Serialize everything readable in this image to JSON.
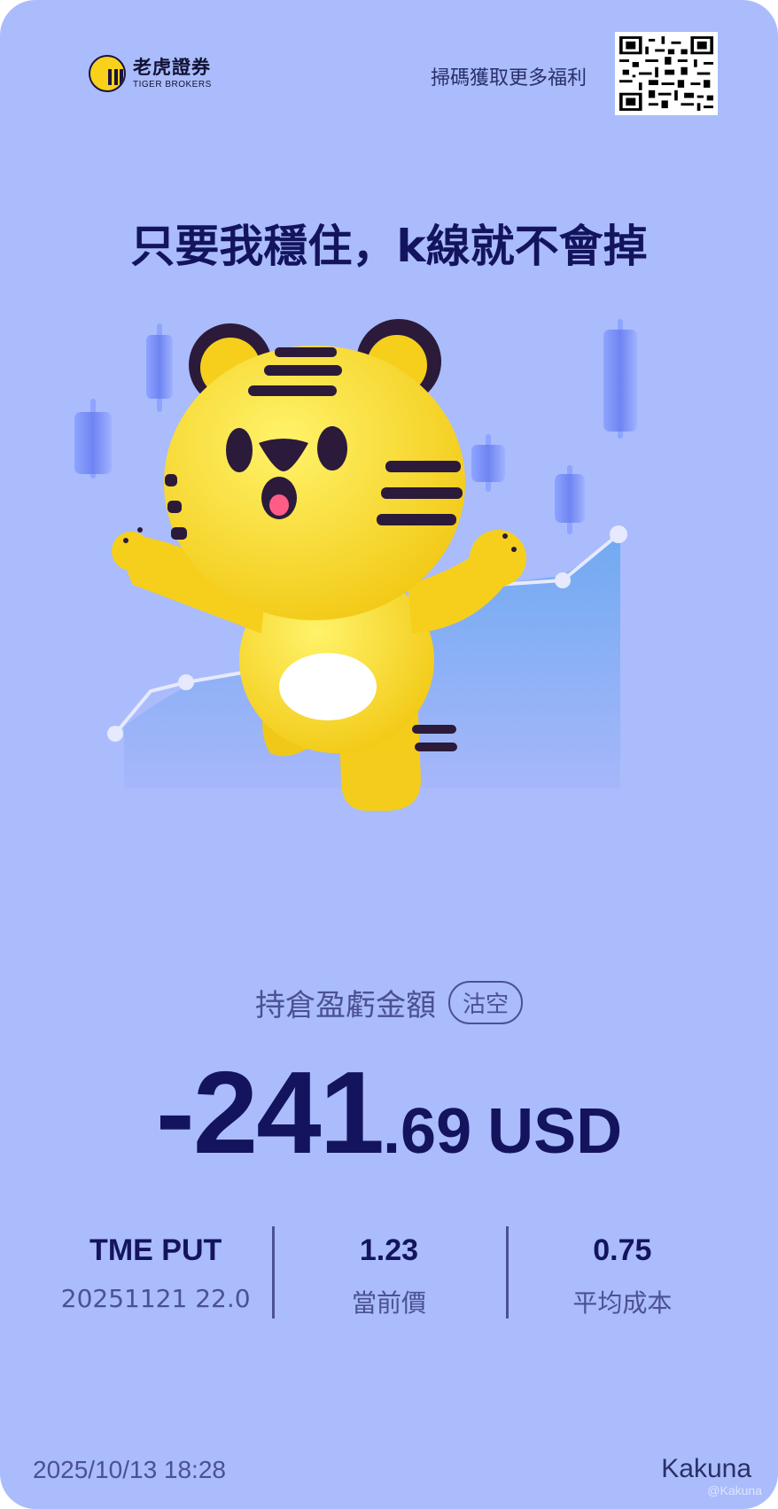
{
  "header": {
    "logo_cn": "老虎證券",
    "logo_en": "TIGER BROKERS",
    "scan_text": "掃碼獲取更多福利"
  },
  "headline": "只要我穩住，k線就不會掉",
  "position": {
    "label": "持倉盈虧金額",
    "side_badge": "沽空",
    "amount_int": "-241",
    "amount_dec": ".69",
    "currency": "USD"
  },
  "stats": [
    {
      "top": "TME PUT",
      "bottom": "20251121 22.0"
    },
    {
      "top": "1.23",
      "bottom": "當前價"
    },
    {
      "top": "0.75",
      "bottom": "平均成本"
    }
  ],
  "footer": {
    "timestamp": "2025/10/13 18:28",
    "user": "Kakuna",
    "watermark": "@Kakuna"
  },
  "colors": {
    "background": "#aabcfb",
    "primary_text": "#14145e",
    "secondary_text": "#4b5192",
    "tiger_yellow": "#f8d21a",
    "stripe": "#2b1a3a"
  },
  "icons": [
    "tiger-brokers-logo",
    "qr-code",
    "tiger-mascot"
  ]
}
